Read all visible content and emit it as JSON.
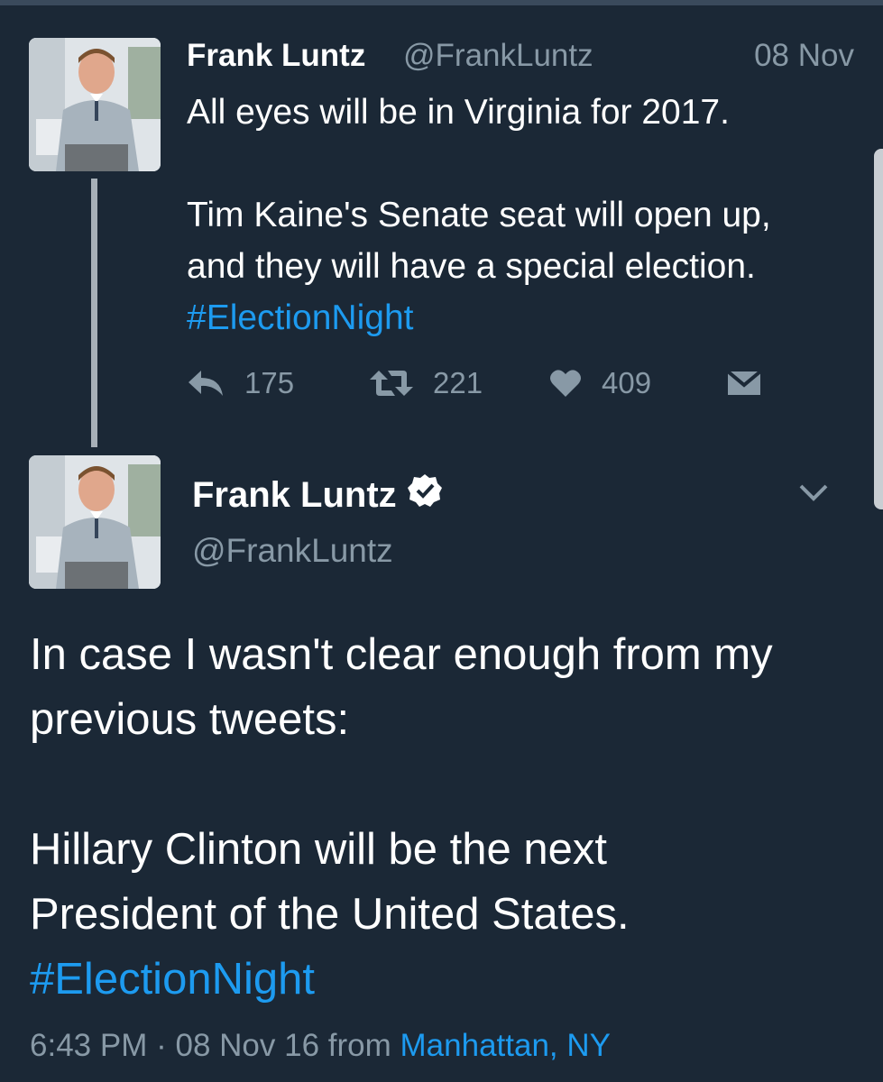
{
  "colors": {
    "background": "#1b2836",
    "text": "#ffffff",
    "secondary_text": "#8899a6",
    "link": "#1d9bf0"
  },
  "reply_tweet": {
    "name": "Frank Luntz",
    "handle": "@FrankLuntz",
    "date": "08 Nov",
    "line1": "All eyes will be in Virginia for 2017.",
    "line2": "Tim Kaine's Senate seat will open up,",
    "line3": "and they will have a special election.",
    "hashtag": "#ElectionNight",
    "actions": {
      "reply_icon": "reply-icon",
      "reply_count": "175",
      "retweet_icon": "retweet-icon",
      "retweet_count": "221",
      "like_icon": "heart-icon",
      "like_count": "409",
      "dm_icon": "envelope-icon"
    }
  },
  "main_tweet": {
    "name": "Frank Luntz",
    "verified_icon": "verified-badge-icon",
    "handle": "@FrankLuntz",
    "menu_icon": "chevron-down-icon",
    "line1": "In case I wasn't clear enough from my",
    "line2": "previous tweets:",
    "line3": "Hillary Clinton will be the next",
    "line4": "President of the United States.",
    "hashtag": "#ElectionNight",
    "time": "6:43 PM",
    "separator": "·",
    "date": "08 Nov 16",
    "from_label": "from",
    "location": "Manhattan, NY"
  }
}
